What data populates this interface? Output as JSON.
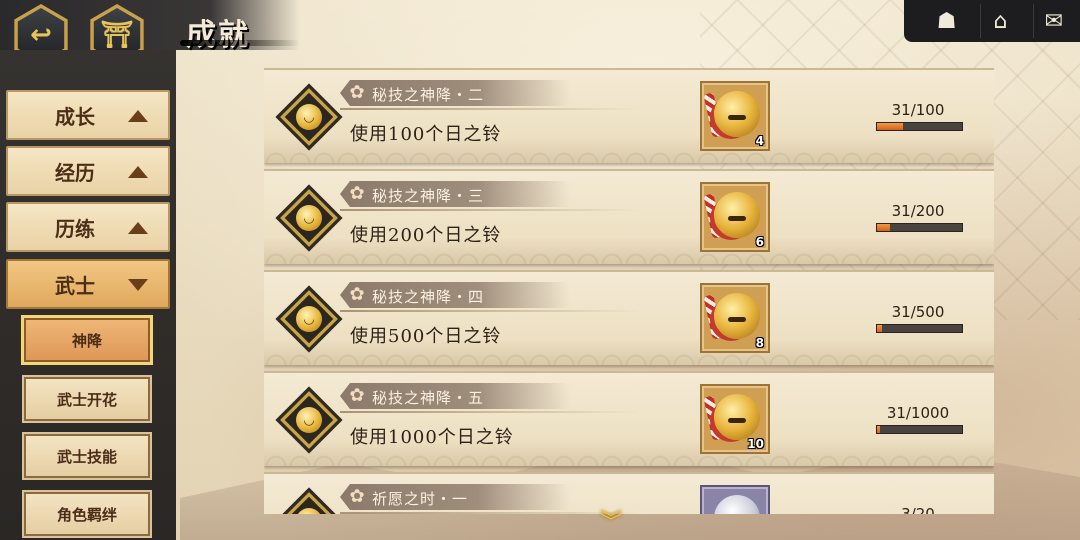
{
  "header": {
    "title": "成就",
    "back_icon": "back-arrow-icon",
    "home_icon": "castle-icon"
  },
  "top_right": {
    "icons": [
      "character-icon",
      "home-upgrade-icon",
      "mail-icon"
    ]
  },
  "sidebar": {
    "categories": [
      {
        "label": "成长",
        "state": "collapsed"
      },
      {
        "label": "经历",
        "state": "collapsed"
      },
      {
        "label": "历练",
        "state": "collapsed"
      },
      {
        "label": "武士",
        "state": "expanded"
      }
    ],
    "sub_items": [
      {
        "label": "神降",
        "active": true
      },
      {
        "label": "武士开花",
        "active": false
      },
      {
        "label": "武士技能",
        "active": false
      },
      {
        "label": "角色羁绊",
        "active": false
      }
    ]
  },
  "achievements": [
    {
      "subtitle": "秘技之神降・二",
      "desc": "使用100个日之铃",
      "reward_qty": "4",
      "progress_text": "31/100",
      "progress": 0.31,
      "reward_type": "gold-bell"
    },
    {
      "subtitle": "秘技之神降・三",
      "desc": "使用200个日之铃",
      "reward_qty": "6",
      "progress_text": "31/200",
      "progress": 0.155,
      "reward_type": "gold-bell"
    },
    {
      "subtitle": "秘技之神降・四",
      "desc": "使用500个日之铃",
      "reward_qty": "8",
      "progress_text": "31/500",
      "progress": 0.062,
      "reward_type": "gold-bell"
    },
    {
      "subtitle": "秘技之神降・五",
      "desc": "使用1000个日之铃",
      "reward_qty": "10",
      "progress_text": "31/1000",
      "progress": 0.031,
      "reward_type": "gold-bell"
    },
    {
      "subtitle": "祈愿之时・一",
      "desc": "",
      "reward_qty": "",
      "progress_text": "3/20",
      "progress": 0.15,
      "reward_type": "silver-item"
    }
  ],
  "colors": {
    "accent_gold": "#c9a14a",
    "progress_fill": "#e07a2c",
    "sidebar_bg": "#2f2c29"
  },
  "scroll_indicator_icon": "chevron-double-down-icon"
}
